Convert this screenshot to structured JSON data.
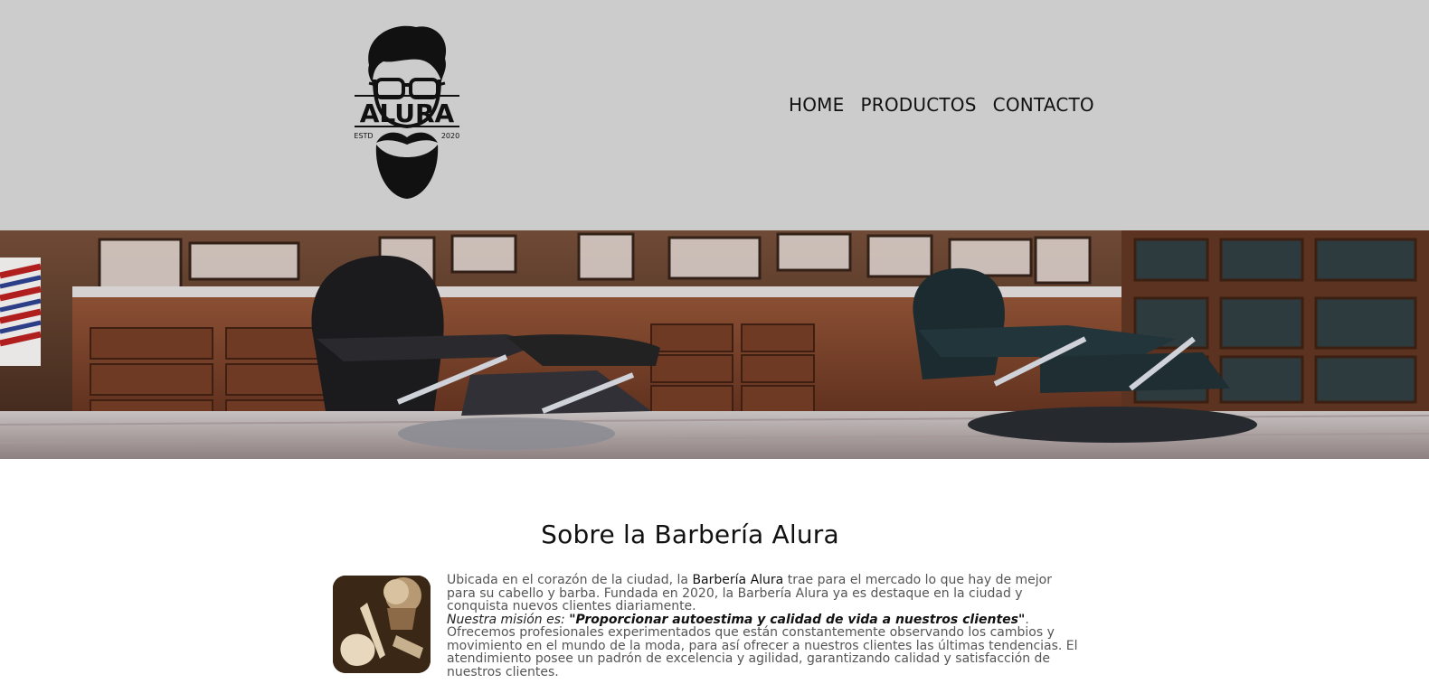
{
  "brand": {
    "name": "ALURA",
    "estd": "ESTD",
    "year": "2020"
  },
  "nav": {
    "items": [
      "HOME",
      "PRODUCTOS",
      "CONTACTO"
    ]
  },
  "about": {
    "title": "Sobre la Barbería Alura",
    "p1_a": "Ubicada en el corazón de la ciudad, la ",
    "p1_b": "Barbería Alura",
    "p1_c": " trae para el mercado lo que hay de mejor para su cabello y barba. Fundada en 2020, la Barbería Alura ya es destaque en la ciudad y conquista nuevos clientes diariamente.",
    "mision_label": "Nuestra misión es: ",
    "mision_quote": "\"Proporcionar autoestima y calidad de vida a nuestros clientes\"",
    "mision_end": ".",
    "p2": "Ofrecemos profesionales experimentados que están constantemente observando los cambios y movimiento en el mundo de la moda, para así ofrecer a nuestros clientes las últimas tendencias. El atendimiento posee un padrón de excelencia y agilidad, garantizando calidad y satisfacción de nuestros clientes."
  },
  "colors": {
    "header_bg": "#cccccc",
    "page_bg": "#ffffff",
    "text": "#111111"
  }
}
